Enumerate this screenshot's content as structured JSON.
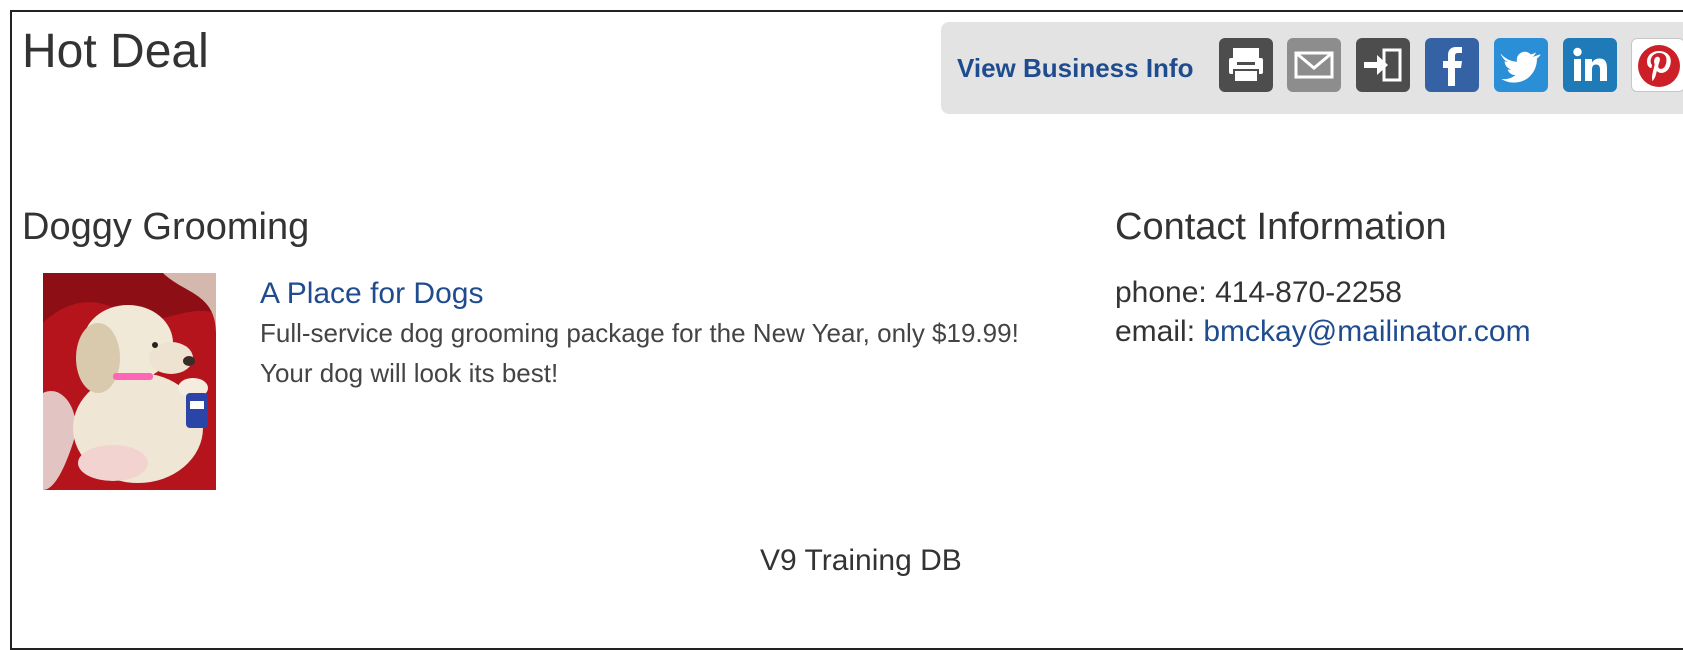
{
  "header": {
    "title": "Hot Deal"
  },
  "actions": {
    "view_business_info": "View Business Info",
    "icons": [
      {
        "name": "print-icon",
        "color": "#4d4d4d"
      },
      {
        "name": "email-icon",
        "color": "#8d8d8d"
      },
      {
        "name": "share-icon",
        "color": "#4d4d4d"
      },
      {
        "name": "facebook-icon",
        "color": "#3462a5"
      },
      {
        "name": "twitter-icon",
        "color": "#2a8fd6"
      },
      {
        "name": "linkedin-icon",
        "color": "#1f7ab8"
      },
      {
        "name": "pinterest-icon",
        "color": "#cc1f27"
      }
    ]
  },
  "deal": {
    "section_title": "Doggy Grooming",
    "business_name": "A Place for Dogs",
    "description": "Full-service dog grooming package for the New Year, only $19.99! Your dog will look its best!"
  },
  "contact": {
    "section_title": "Contact Information",
    "phone_label": "phone:",
    "phone": "414-870-2258",
    "email_label": "email:",
    "email": "bmckay@mailinator.com"
  },
  "footer": {
    "text": "V9 Training DB"
  },
  "colors": {
    "link": "#1f4c8f",
    "text": "#333333",
    "bar_background": "#e3e3e3"
  }
}
